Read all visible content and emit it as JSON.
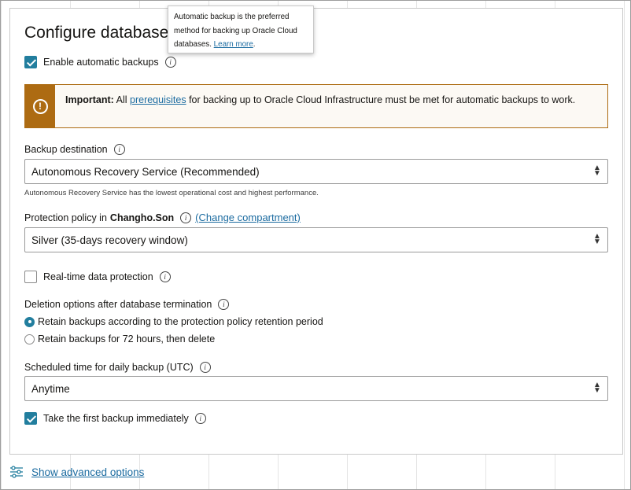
{
  "title": "Configure database b",
  "tooltip": {
    "text_before_link": "Automatic backup is the preferred method for backing up Oracle Cloud databases.",
    "link": "Learn more",
    "text_after_link": "."
  },
  "enable_automatic_backups": {
    "label": "Enable automatic backups",
    "checked": true
  },
  "banner": {
    "icon": "warning-icon",
    "strong": "Important:",
    "text_before_link": "All",
    "link": "prerequisites",
    "text_after_link": "for backing up to Oracle Cloud Infrastructure must be met for automatic backups to work."
  },
  "backup_destination": {
    "label": "Backup destination",
    "selected": "Autonomous Recovery Service (Recommended)",
    "help": "Autonomous Recovery Service has the lowest operational cost and highest performance."
  },
  "protection_policy": {
    "label_prefix": "Protection policy in",
    "compartment": "Changho.Son",
    "change_link": "(Change compartment)",
    "selected": "Silver (35-days recovery window)"
  },
  "real_time": {
    "label": "Real-time data protection",
    "checked": false
  },
  "deletion_options": {
    "label": "Deletion options after database termination",
    "options": [
      {
        "label": "Retain backups according to the protection policy retention period",
        "selected": true
      },
      {
        "label": "Retain backups for 72 hours, then delete",
        "selected": false
      }
    ]
  },
  "scheduled_time": {
    "label": "Scheduled time for daily backup (UTC)",
    "selected": "Anytime"
  },
  "first_backup": {
    "label": "Take the first backup immediately",
    "checked": true
  },
  "advanced_options": {
    "label": "Show advanced options",
    "icon": "sliders-icon"
  },
  "colors": {
    "accent": "#227e9e",
    "warning": "#ad6b12",
    "link": "#1b6ba0"
  }
}
